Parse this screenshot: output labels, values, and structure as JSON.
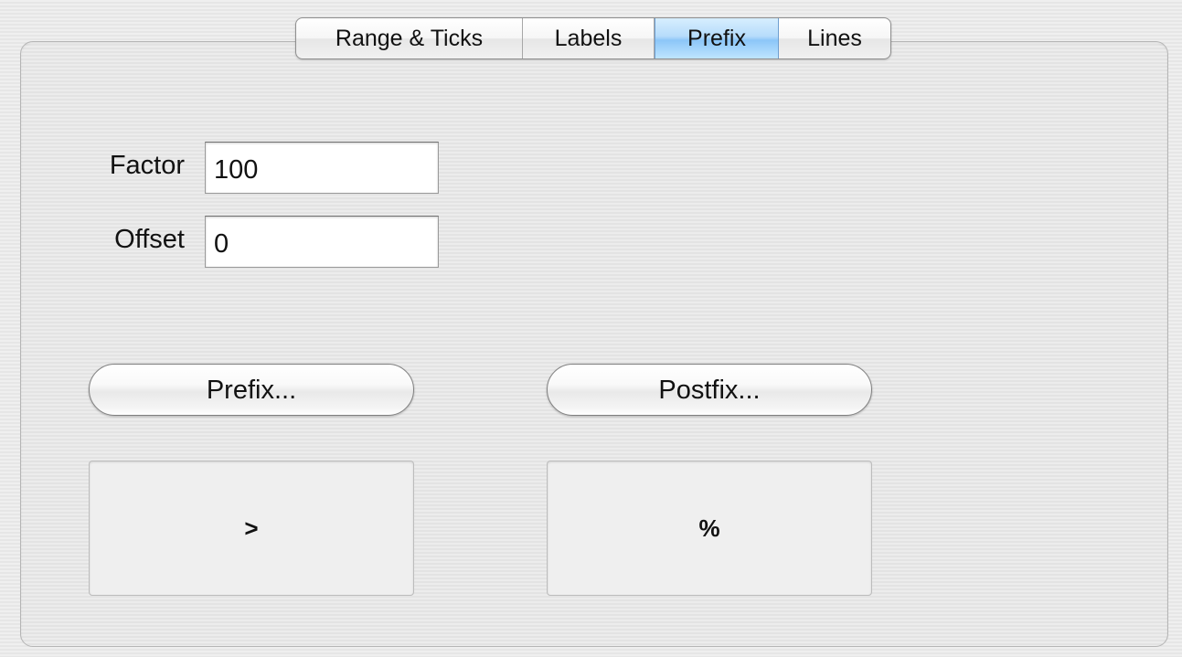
{
  "tabs": [
    {
      "label": "Range & Ticks",
      "selected": false
    },
    {
      "label": "Labels",
      "selected": false
    },
    {
      "label": "Prefix",
      "selected": true
    },
    {
      "label": "Lines",
      "selected": false
    }
  ],
  "form": {
    "factor": {
      "label": "Factor",
      "value": "100"
    },
    "offset": {
      "label": "Offset",
      "value": "0"
    }
  },
  "buttons": {
    "prefix_label": "Prefix...",
    "postfix_label": "Postfix..."
  },
  "previews": {
    "prefix_text": ">",
    "postfix_text": "%"
  },
  "colors": {
    "selected_tab": "#b6dcfb",
    "panel_background": "#e9e9e9"
  }
}
